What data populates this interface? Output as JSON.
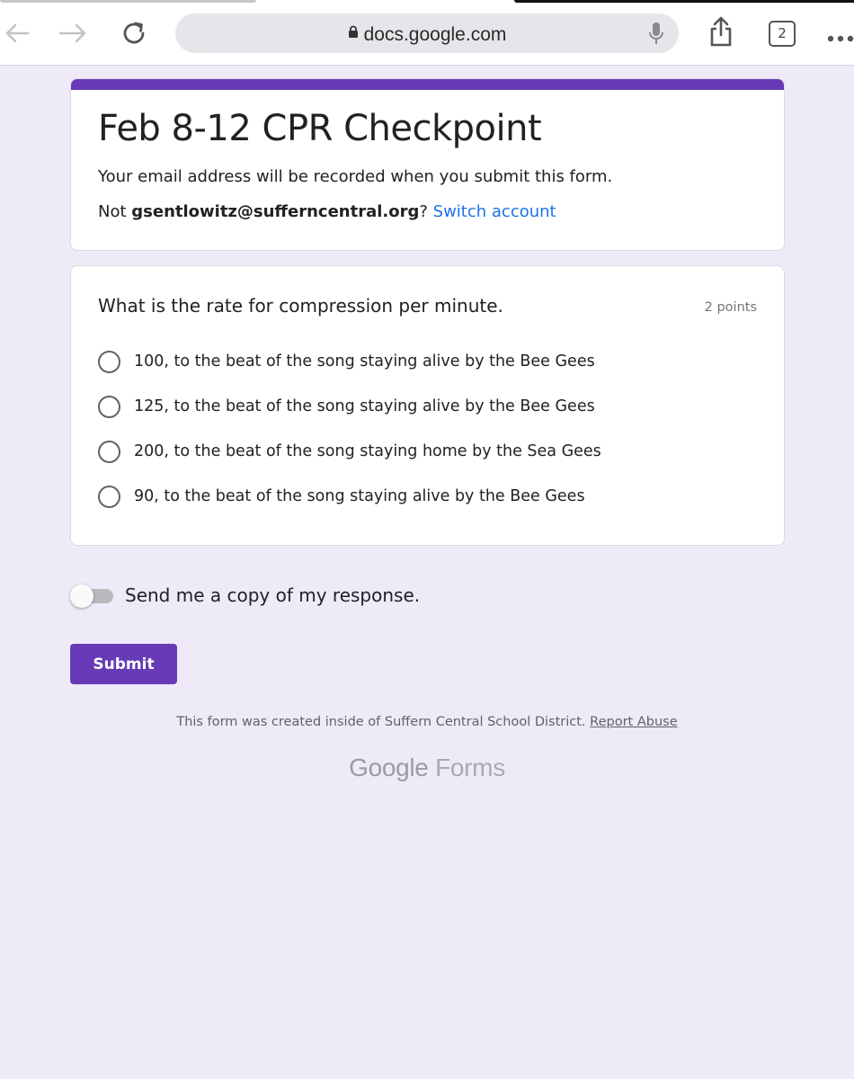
{
  "browser": {
    "url": "docs.google.com",
    "tab_count": "2",
    "icons": [
      "back-icon",
      "forward-icon",
      "reload-icon",
      "lock-icon",
      "mic-icon",
      "share-icon",
      "tabs-icon",
      "more-icon"
    ]
  },
  "form": {
    "title": "Feb 8-12 CPR Checkpoint",
    "email_note": "Your email address will be recorded when you submit this form.",
    "account_prefix": "Not ",
    "account_email": "gsentlowitz@sufferncentral.org",
    "account_suffix": "? ",
    "switch_account": "Switch account",
    "accent_color": "#673ab7"
  },
  "question": {
    "text": "What is the rate for compression per minute.",
    "points": "2 points",
    "options": [
      "100, to the beat of the song staying alive by the Bee Gees",
      "125, to the beat of the song staying alive by the Bee Gees",
      "200, to the beat of the song staying home by the Sea Gees",
      "90, to the beat of the song staying alive by the Bee Gees"
    ]
  },
  "copy_toggle": {
    "label": "Send me a copy of my response.",
    "checked": false
  },
  "submit_label": "Submit",
  "footer": {
    "note": "This form was created inside of Suffern Central School District.",
    "report": "Report Abuse",
    "logo_brand": "Google",
    "logo_product": "Forms"
  }
}
